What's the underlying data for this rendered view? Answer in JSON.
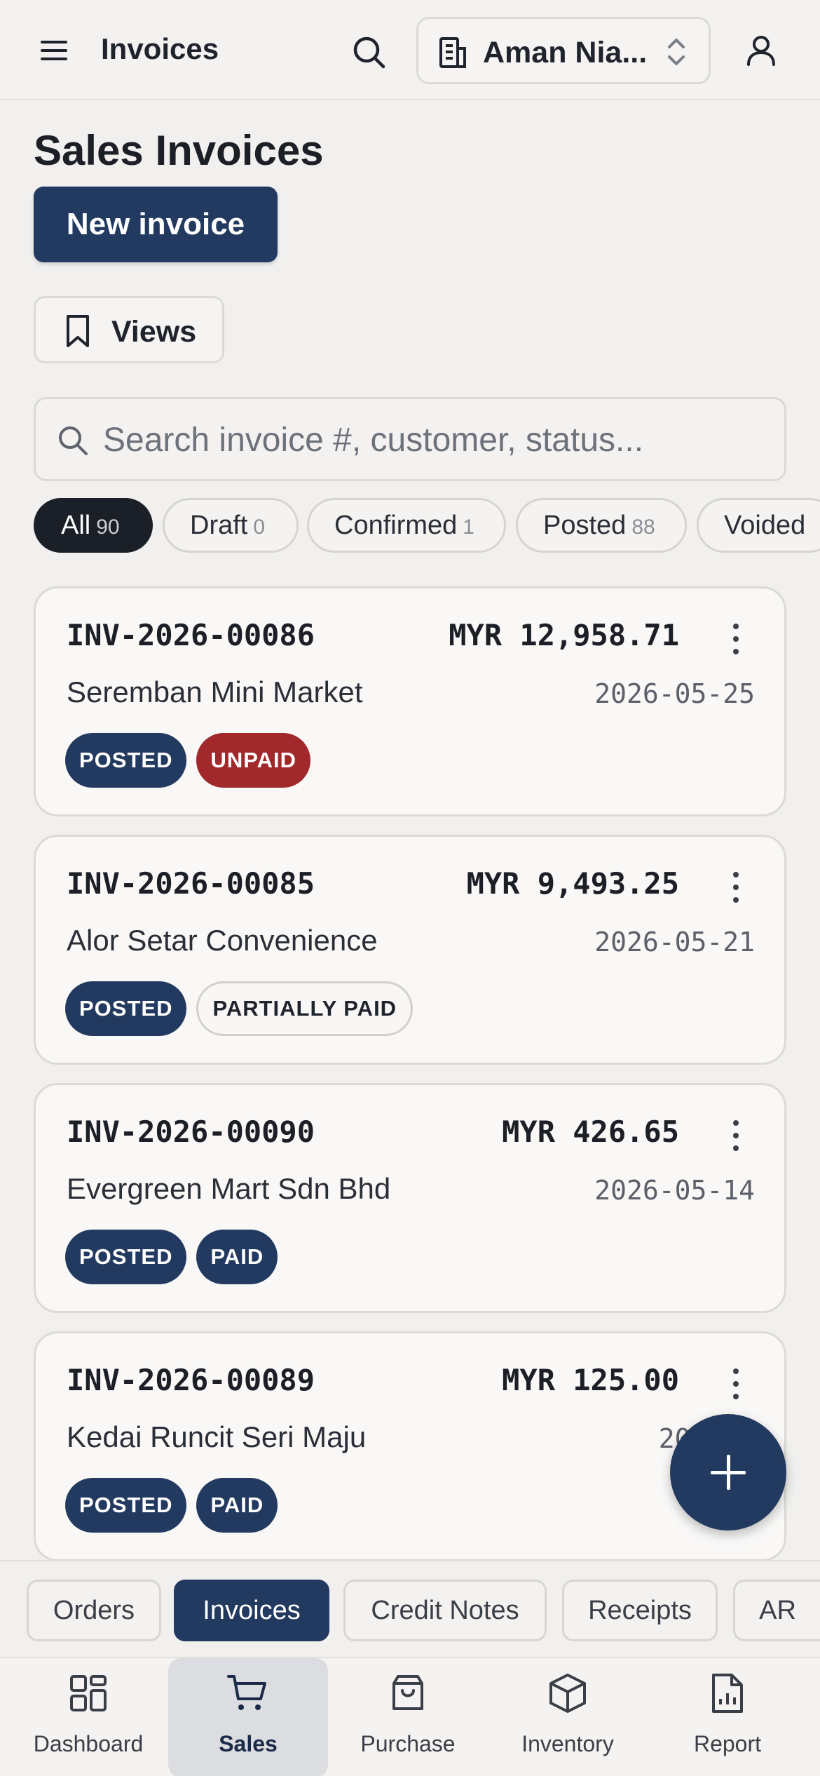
{
  "header": {
    "title": "Invoices",
    "org_name": "Aman Nia..."
  },
  "page": {
    "title": "Sales Invoices",
    "new_invoice_label": "New invoice",
    "views_label": "Views",
    "search_placeholder": "Search invoice #, customer, status..."
  },
  "filters": [
    {
      "label": "All",
      "count": "90",
      "active": true
    },
    {
      "label": "Draft",
      "count": "0"
    },
    {
      "label": "Confirmed",
      "count": "1"
    },
    {
      "label": "Posted",
      "count": "88"
    },
    {
      "label": "Voided",
      "count": ""
    }
  ],
  "invoices": [
    {
      "number": "INV-2026-00086",
      "amount": "MYR 12,958.71",
      "customer": "Seremban Mini Market",
      "date": "2026-05-25",
      "badges": [
        "POSTED",
        "UNPAID"
      ]
    },
    {
      "number": "INV-2026-00085",
      "amount": "MYR 9,493.25",
      "customer": "Alor Setar Convenience",
      "date": "2026-05-21",
      "badges": [
        "POSTED",
        "PARTIALLY PAID"
      ]
    },
    {
      "number": "INV-2026-00090",
      "amount": "MYR 426.65",
      "customer": "Evergreen Mart Sdn Bhd",
      "date": "2026-05-14",
      "badges": [
        "POSTED",
        "PAID"
      ]
    },
    {
      "number": "INV-2026-00089",
      "amount": "MYR 125.00",
      "customer": "Kedai Runcit Seri Maju",
      "date": "2026-0",
      "badges": [
        "POSTED",
        "PAID"
      ]
    }
  ],
  "subtabs": [
    {
      "label": "Orders"
    },
    {
      "label": "Invoices",
      "active": true
    },
    {
      "label": "Credit Notes"
    },
    {
      "label": "Receipts"
    },
    {
      "label": "AR"
    }
  ],
  "bottom_nav": [
    {
      "label": "Dashboard",
      "icon": "dashboard-icon"
    },
    {
      "label": "Sales",
      "icon": "cart-icon",
      "active": true
    },
    {
      "label": "Purchase",
      "icon": "shopping-bag-icon"
    },
    {
      "label": "Inventory",
      "icon": "box-icon"
    },
    {
      "label": "Report",
      "icon": "report-icon"
    }
  ],
  "colors": {
    "primary": "#233a60",
    "unpaid": "#a1282b",
    "active_chip": "#1b1f27",
    "background": "#f1f0ef"
  }
}
